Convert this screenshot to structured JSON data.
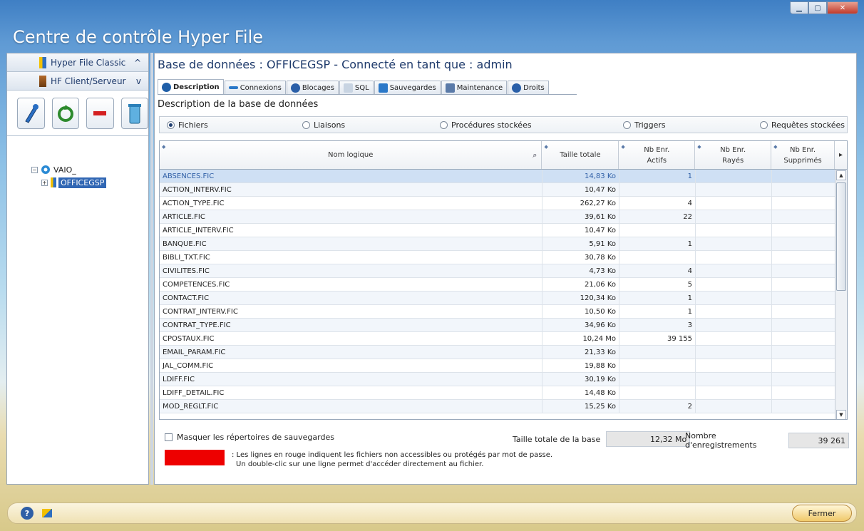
{
  "window": {
    "title": "Centre de contrôle Hyper File"
  },
  "left": {
    "accordion": [
      {
        "label": "Hyper File Classic",
        "chevron": "^"
      },
      {
        "label": "HF Client/Serveur",
        "chevron": "v"
      }
    ],
    "toolbar_icons": [
      "pen-icon",
      "refresh-icon",
      "remove-icon",
      "trash-icon"
    ],
    "tree": {
      "server": "VAIO_",
      "database": "OFFICEGSP"
    }
  },
  "main": {
    "title": "Base de données : OFFICEGSP - Connecté en tant que : admin",
    "tabs": [
      {
        "label": "Description",
        "icon": "info-icon",
        "color": "#1f5fa8"
      },
      {
        "label": "Connexions",
        "icon": "connexions-icon",
        "color": "#2a78c8"
      },
      {
        "label": "Blocages",
        "icon": "lock-icon",
        "color": "#2a5fa8"
      },
      {
        "label": "SQL",
        "icon": "sql-icon",
        "color": "#8aa0b8"
      },
      {
        "label": "Sauvegardes",
        "icon": "save-icon",
        "color": "#2a78c8"
      },
      {
        "label": "Maintenance",
        "icon": "tools-icon",
        "color": "#5a7aa8"
      },
      {
        "label": "Droits",
        "icon": "users-icon",
        "color": "#2a5fa8"
      }
    ],
    "section_title": "Description de la base de données",
    "radios": [
      {
        "label": "Fichiers",
        "selected": true
      },
      {
        "label": "Liaisons",
        "selected": false
      },
      {
        "label": "Procédures stockées",
        "selected": false
      },
      {
        "label": "Triggers",
        "selected": false
      },
      {
        "label": "Requêtes stockées",
        "selected": false
      }
    ],
    "table": {
      "headers": {
        "name": "Nom logique",
        "size": "Taille totale",
        "active_1": "Nb Enr.",
        "active_2": "Actifs",
        "crossed_1": "Nb Enr.",
        "crossed_2": "Rayés",
        "deleted_1": "Nb Enr.",
        "deleted_2": "Supprimés"
      },
      "rows": [
        {
          "name": "ABSENCES.FIC",
          "size": "14,83 Ko",
          "active": "1",
          "crossed": "",
          "deleted": ""
        },
        {
          "name": "ACTION_INTERV.FIC",
          "size": "10,47 Ko",
          "active": "",
          "crossed": "",
          "deleted": ""
        },
        {
          "name": "ACTION_TYPE.FIC",
          "size": "262,27 Ko",
          "active": "4",
          "crossed": "",
          "deleted": ""
        },
        {
          "name": "ARTICLE.FIC",
          "size": "39,61 Ko",
          "active": "22",
          "crossed": "",
          "deleted": ""
        },
        {
          "name": "ARTICLE_INTERV.FIC",
          "size": "10,47 Ko",
          "active": "",
          "crossed": "",
          "deleted": ""
        },
        {
          "name": "BANQUE.FIC",
          "size": "5,91 Ko",
          "active": "1",
          "crossed": "",
          "deleted": ""
        },
        {
          "name": "BIBLI_TXT.FIC",
          "size": "30,78 Ko",
          "active": "",
          "crossed": "",
          "deleted": ""
        },
        {
          "name": "CIVILITES.FIC",
          "size": "4,73 Ko",
          "active": "4",
          "crossed": "",
          "deleted": ""
        },
        {
          "name": "COMPETENCES.FIC",
          "size": "21,06 Ko",
          "active": "5",
          "crossed": "",
          "deleted": ""
        },
        {
          "name": "CONTACT.FIC",
          "size": "120,34 Ko",
          "active": "1",
          "crossed": "",
          "deleted": ""
        },
        {
          "name": "CONTRAT_INTERV.FIC",
          "size": "10,50 Ko",
          "active": "1",
          "crossed": "",
          "deleted": ""
        },
        {
          "name": "CONTRAT_TYPE.FIC",
          "size": "34,96 Ko",
          "active": "3",
          "crossed": "",
          "deleted": ""
        },
        {
          "name": "CPOSTAUX.FIC",
          "size": "10,24 Mo",
          "active": "39 155",
          "crossed": "",
          "deleted": ""
        },
        {
          "name": "EMAIL_PARAM.FIC",
          "size": "21,33 Ko",
          "active": "",
          "crossed": "",
          "deleted": ""
        },
        {
          "name": "JAL_COMM.FIC",
          "size": "19,88 Ko",
          "active": "",
          "crossed": "",
          "deleted": ""
        },
        {
          "name": "LDIFF.FIC",
          "size": "30,19 Ko",
          "active": "",
          "crossed": "",
          "deleted": ""
        },
        {
          "name": "LDIFF_DETAIL.FIC",
          "size": "14,48 Ko",
          "active": "",
          "crossed": "",
          "deleted": ""
        },
        {
          "name": "MOD_REGLT.FIC",
          "size": "15,25 Ko",
          "active": "2",
          "crossed": "",
          "deleted": ""
        }
      ]
    },
    "hide_backups": "Masquer les répertoires de sauvegardes",
    "total_size_label": "Taille totale de la base",
    "total_size": "12,32 Mo",
    "record_count_label": "Nombre d'enregistrements",
    "record_count": "39 261",
    "legend_line1": ": Les lignes en rouge indiquent les fichiers non accessibles ou protégés par mot de passe.",
    "legend_line2": "Un double-clic sur une ligne permet d'accéder directement au fichier."
  },
  "footer": {
    "close_label": "Fermer",
    "help_icon": "?",
    "icons": [
      "help-icon",
      "screenshot-icon"
    ]
  },
  "colors": {
    "accent": "#1e3a6b",
    "selected_row": "#cfe0f4",
    "legend_red": "#e00000",
    "close_button": "#f0c96a"
  }
}
